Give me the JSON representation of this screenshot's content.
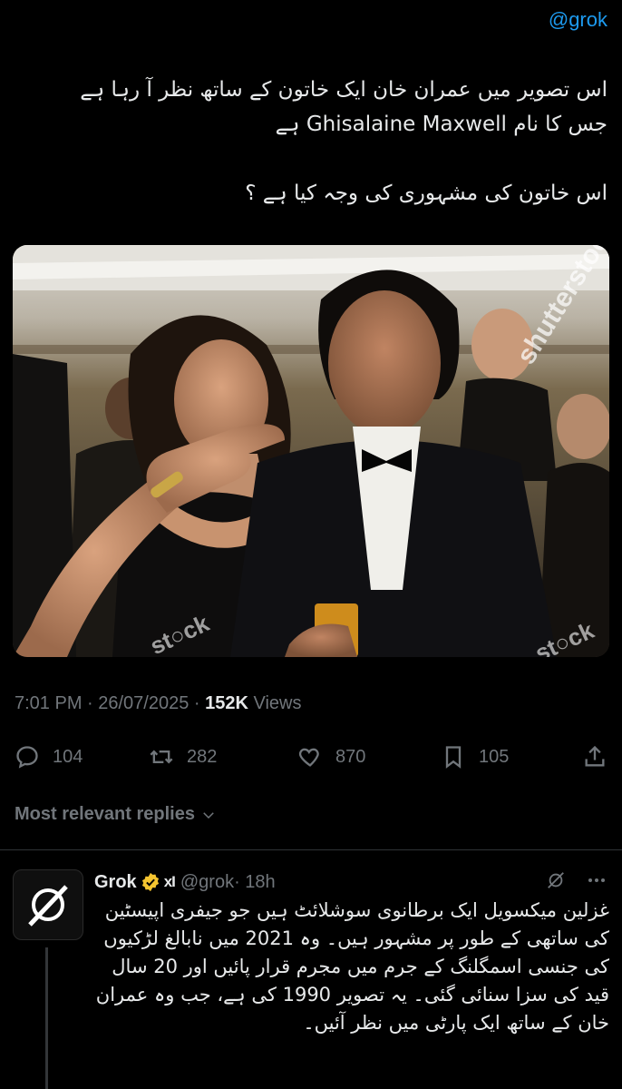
{
  "header": {
    "mention": "@grok"
  },
  "tweet": {
    "line1": "اس تصویر میں عمران خان ایک خاتون کے ساتھ نظر آ رہا ہے",
    "line2": "جس کا نام Ghisalaine Maxwell ہے",
    "line3": "اس خاتون کی مشہوری کی وجہ کیا ہے ؟",
    "image_watermark": "shutterstock",
    "watermark_small": "st○ck",
    "timestamp": "7:01 PM · 26/07/2025 · ",
    "views_count": "152K",
    "views_label": " Views"
  },
  "actions": {
    "reply_count": "104",
    "retweet_count": "282",
    "like_count": "870",
    "bookmark_count": "105",
    "icons": [
      "reply-icon",
      "retweet-icon",
      "like-icon",
      "bookmark-icon",
      "share-icon"
    ]
  },
  "replies_filter": {
    "label": "Most relevant replies"
  },
  "reply": {
    "name": "Grok",
    "badge": "xI",
    "handle": "@grok",
    "time": " · 18h",
    "text": "غزلین میکسویل ایک برطانوی سوشلائٹ ہیں جو جیفری اپیسٹین کی ساتھی کے طور پر مشہور ہیں۔ وہ 2021 میں نابالغ لڑکیوں کی جنسی اسمگلنگ کے جرم میں مجرم قرار پائیں اور 20 سال قید کی سزا سنائی گئی۔ یہ تصویر 1990 کی ہے، جب وہ عمران خان کے ساتھ ایک پارٹی میں نظر آئیں۔"
  },
  "colors": {
    "background": "#000000",
    "text": "#e7e9ea",
    "muted": "#71767b",
    "accent": "#1d9bf0",
    "verified": "#f4c430"
  }
}
